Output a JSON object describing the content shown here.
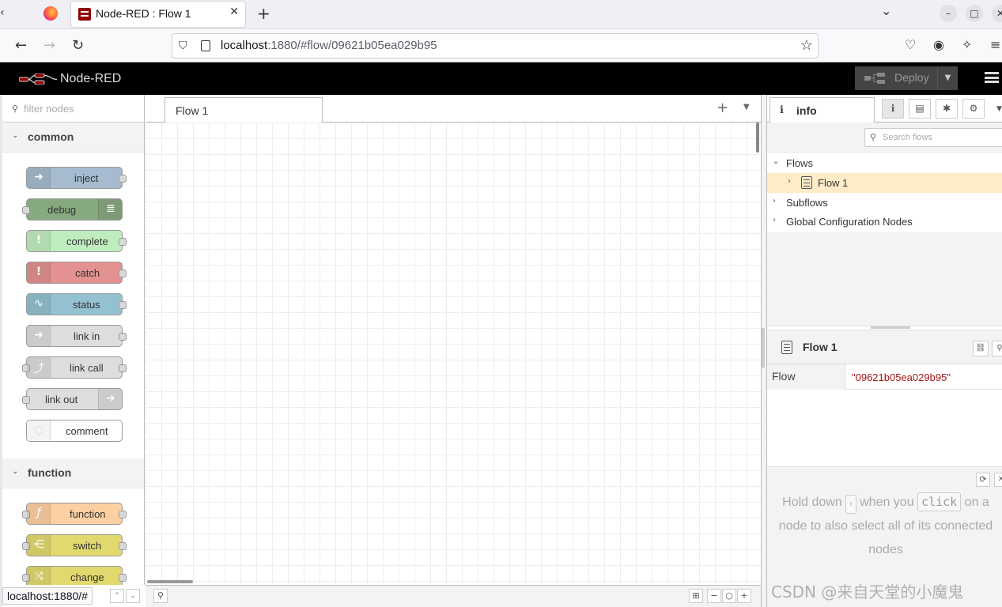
{
  "browser": {
    "tab_title": "Node-RED : Flow 1",
    "url_host": "localhost",
    "url_rest": ":1880/#flow/09621b05ea029b95",
    "status_url": "localhost:1880/#"
  },
  "header": {
    "title": "Node-RED",
    "deploy_label": "Deploy"
  },
  "palette": {
    "filter_placeholder": "filter nodes",
    "categories": [
      {
        "label": "common",
        "nodes": [
          {
            "label": "inject",
            "color": "#a6bbcf"
          },
          {
            "label": "debug",
            "color": "#87a980"
          },
          {
            "label": "complete",
            "color": "#c0edc0"
          },
          {
            "label": "catch",
            "color": "#e49191"
          },
          {
            "label": "status",
            "color": "#94c1d0"
          },
          {
            "label": "link in",
            "color": "#dddddd"
          },
          {
            "label": "link call",
            "color": "#dddddd"
          },
          {
            "label": "link out",
            "color": "#dddddd"
          },
          {
            "label": "comment",
            "color": "#ffffff"
          }
        ]
      },
      {
        "label": "function",
        "nodes": [
          {
            "label": "function",
            "color": "#fdd0a2"
          },
          {
            "label": "switch",
            "color": "#e2d96e"
          },
          {
            "label": "change",
            "color": "#e2d96e"
          }
        ]
      }
    ]
  },
  "workspace": {
    "tabs": [
      {
        "label": "Flow 1"
      }
    ]
  },
  "sidebar": {
    "tab_label": "info",
    "search_placeholder": "Search flows",
    "tree": {
      "flows_label": "Flows",
      "flow_item": "Flow 1",
      "subflows_label": "Subflows",
      "global_config_label": "Global Configuration Nodes"
    },
    "detail": {
      "title": "Flow 1",
      "prop_key": "Flow",
      "prop_value": "\"09621b05ea029b95\""
    },
    "tip": {
      "part1": "Hold down",
      "key1": "⇧",
      "part2": "when you",
      "key2": "click",
      "part3": "on a node to also select all of its connected nodes"
    }
  },
  "watermark": "CSDN @来自天堂的小魔鬼"
}
